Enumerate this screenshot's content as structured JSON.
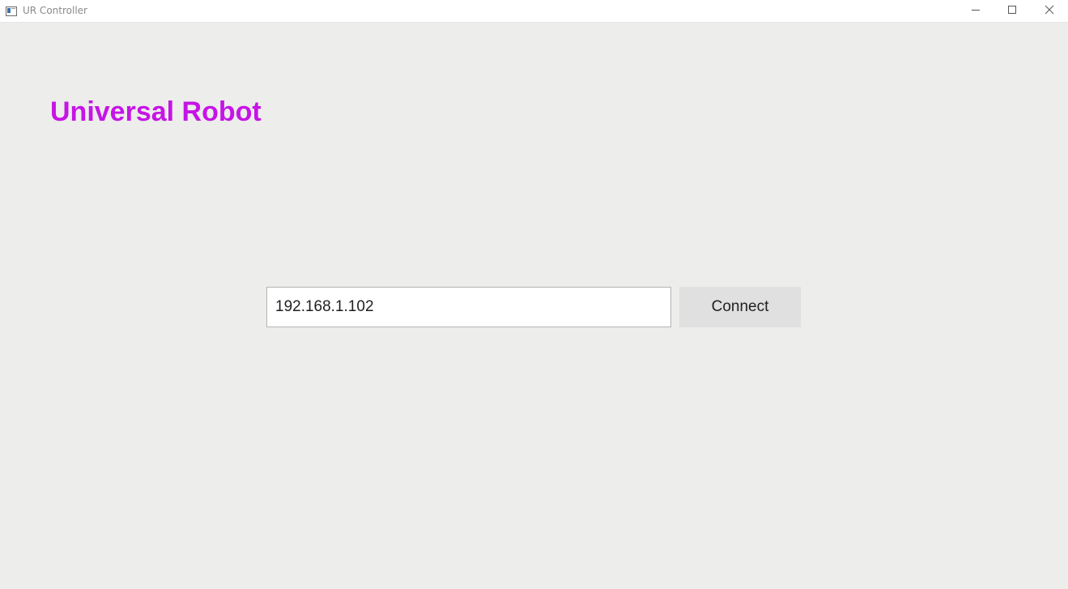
{
  "window": {
    "title": "UR Controller",
    "app_icon": "app-window-icon",
    "controls": {
      "minimize_icon": "minimize-icon",
      "maximize_icon": "maximize-icon",
      "close_icon": "close-icon"
    }
  },
  "main": {
    "heading": "Universal Robot",
    "ip_field": {
      "value": "192.168.1.102",
      "placeholder": ""
    },
    "connect_label": "Connect"
  },
  "colors": {
    "background": "#ededeb",
    "heading": "#c614e6",
    "button_bg": "#e0e0e0",
    "input_border": "#b4b4b4"
  }
}
